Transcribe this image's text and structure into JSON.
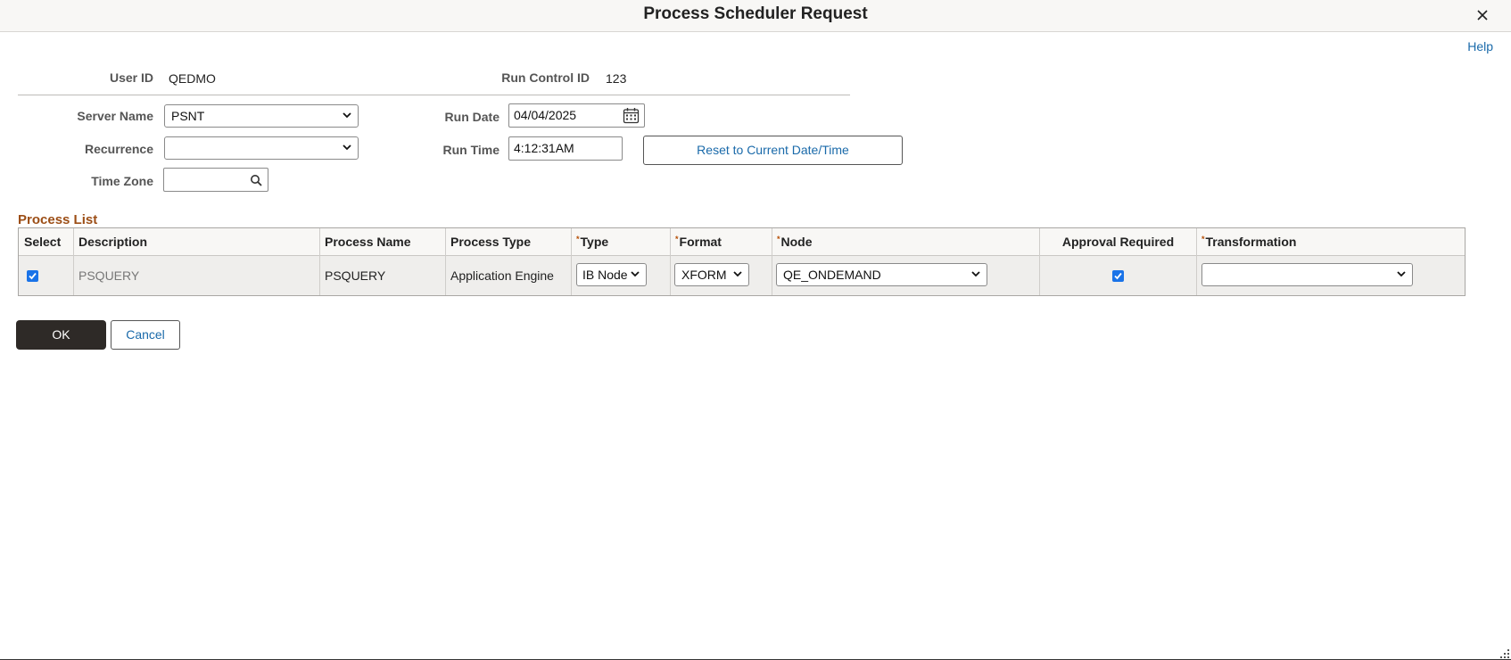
{
  "dialog": {
    "title": "Process Scheduler Request",
    "help_label": "Help",
    "close_icon": "close-icon"
  },
  "header": {
    "user_id_label": "User ID",
    "user_id_value": "QEDMO",
    "run_control_label": "Run Control ID",
    "run_control_value": "123"
  },
  "form": {
    "server_name_label": "Server Name",
    "server_name_value": "PSNT",
    "recurrence_label": "Recurrence",
    "recurrence_value": "",
    "time_zone_label": "Time Zone",
    "time_zone_value": "",
    "run_date_label": "Run Date",
    "run_date_value": "04/04/2025",
    "run_time_label": "Run Time",
    "run_time_value": "4:12:31AM",
    "reset_label": "Reset to Current Date/Time"
  },
  "process_list": {
    "title": "Process List",
    "columns": {
      "select": "Select",
      "description": "Description",
      "process_name": "Process Name",
      "process_type": "Process Type",
      "type": "Type",
      "format": "Format",
      "node": "Node",
      "approval": "Approval Required",
      "transformation": "Transformation"
    },
    "rows": [
      {
        "selected": true,
        "description": "PSQUERY",
        "process_name": "PSQUERY",
        "process_type": "Application Engine",
        "type": "IB Node",
        "format": "XFORM",
        "node": "QE_ONDEMAND",
        "approval_required": true,
        "transformation": ""
      }
    ]
  },
  "actions": {
    "ok_label": "OK",
    "cancel_label": "Cancel"
  },
  "colors": {
    "accent_link": "#1a6aaa",
    "section_title": "#9c4e16",
    "primary_button": "#2e2a27",
    "checkbox": "#1a73e8"
  }
}
